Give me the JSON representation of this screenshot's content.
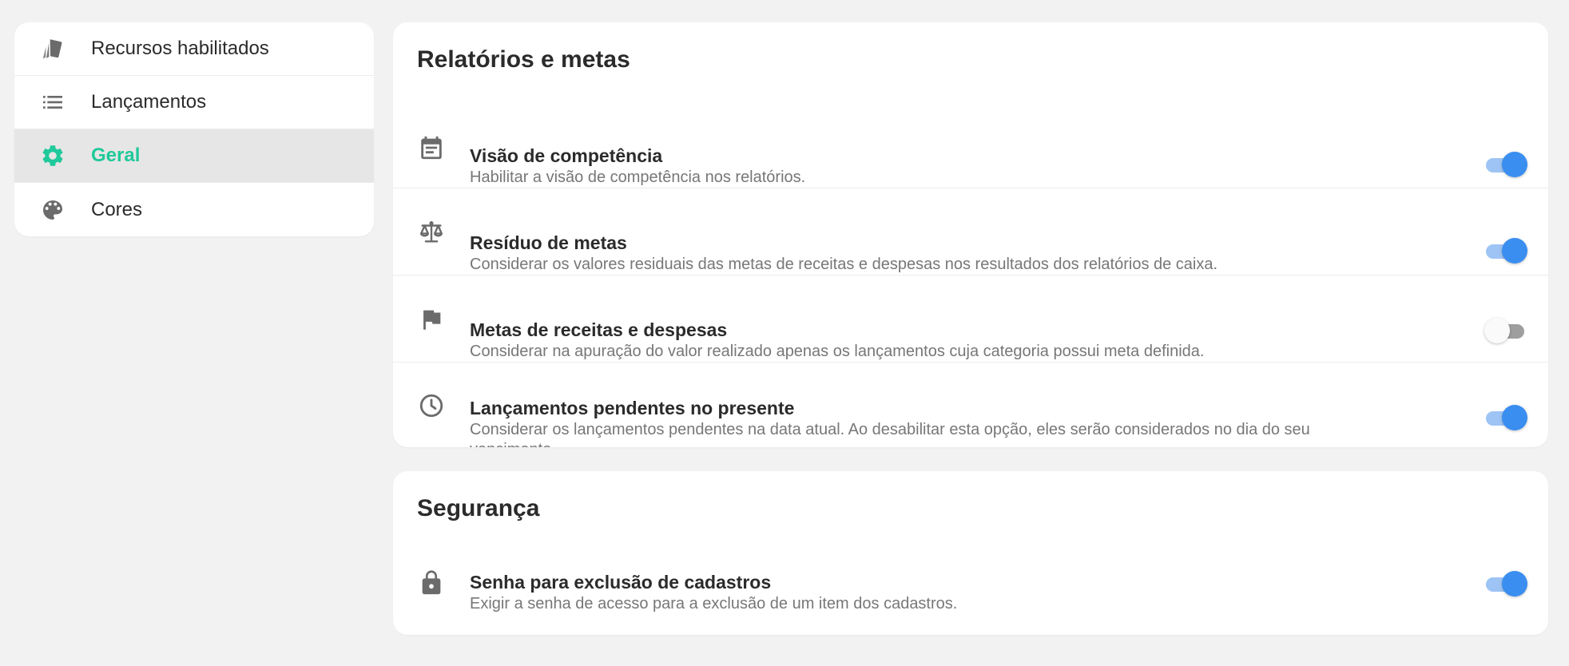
{
  "sidebar": {
    "items": [
      {
        "label": "Recursos habilitados",
        "icon": "cards-icon",
        "active": false
      },
      {
        "label": "Lançamentos",
        "icon": "list-icon",
        "active": false
      },
      {
        "label": "Geral",
        "icon": "gear-icon",
        "active": true
      },
      {
        "label": "Cores",
        "icon": "palette-icon",
        "active": false
      }
    ]
  },
  "colors": {
    "accent": "#1fc99a",
    "toggle_on": "#3a8ef0",
    "background": "#f2f2f2"
  },
  "reports": {
    "title": "Relatórios e metas",
    "rows": [
      {
        "title": "Visão de competência",
        "description": "Habilitar a visão de competência nos relatórios.",
        "icon": "calendar-icon",
        "enabled": true
      },
      {
        "title": "Resíduo de metas",
        "description": "Considerar os valores residuais das metas de receitas e despesas nos resultados dos relatórios de caixa.",
        "icon": "scale-icon",
        "enabled": true
      },
      {
        "title": "Metas de receitas e despesas",
        "description": "Considerar na apuração do valor realizado apenas os lançamentos cuja categoria possui meta definida.",
        "icon": "flag-icon",
        "enabled": false
      },
      {
        "title": "Lançamentos pendentes no presente",
        "description": "Considerar os lançamentos pendentes na data atual. Ao desabilitar esta opção, eles serão considerados no dia do seu vencimento.",
        "icon": "clock-icon",
        "enabled": true
      }
    ]
  },
  "security": {
    "title": "Segurança",
    "rows": [
      {
        "title": "Senha para exclusão de cadastros",
        "description": "Exigir a senha de acesso para a exclusão de um item dos cadastros.",
        "icon": "lock-icon",
        "enabled": true
      }
    ]
  }
}
